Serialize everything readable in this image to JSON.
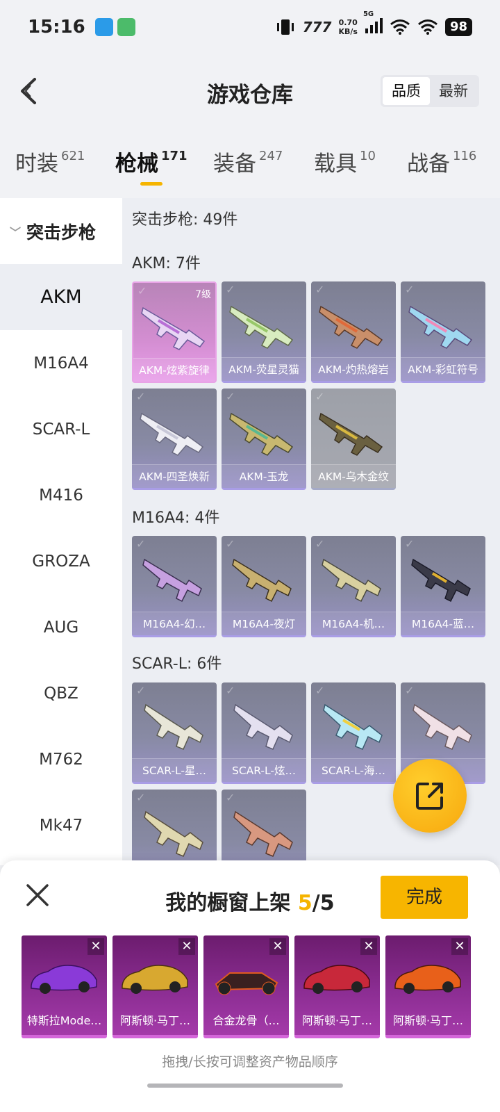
{
  "status": {
    "time": "15:16",
    "net_speed_value": "0.70",
    "net_speed_unit": "KB/s",
    "network": "5G",
    "battery": "98",
    "hd": "777"
  },
  "header": {
    "title": "游戏仓库",
    "sort_options": [
      "品质",
      "最新"
    ]
  },
  "tabs": [
    {
      "label": "时装",
      "count": "621"
    },
    {
      "label": "枪械",
      "count": "171"
    },
    {
      "label": "装备",
      "count": "247"
    },
    {
      "label": "载具",
      "count": "10"
    },
    {
      "label": "战备",
      "count": "116"
    }
  ],
  "sidebar": {
    "group": "突击步枪",
    "items": [
      "AKM",
      "M16A4",
      "SCAR-L",
      "M416",
      "GROZA",
      "AUG",
      "QBZ",
      "M762",
      "Mk47"
    ]
  },
  "content": {
    "category_title": "突击步枪: 49件",
    "sections": [
      {
        "title": "AKM: 7件",
        "items": [
          "AKM-炫紫旋律",
          "AKM-荧星灵猫",
          "AKM-灼热熔岩",
          "AKM-彩虹符号",
          "AKM-四圣焕新",
          "AKM-玉龙",
          "AKM-乌木金纹"
        ],
        "level_badge": "7级"
      },
      {
        "title": "M16A4: 4件",
        "items": [
          "M16A4-幻…",
          "M16A4-夜灯",
          "M16A4-机…",
          "M16A4-蓝…"
        ]
      },
      {
        "title": "SCAR-L: 6件",
        "items": [
          "SCAR-L-星…",
          "SCAR-L-炫…",
          "SCAR-L-海…",
          "…"
        ]
      }
    ]
  },
  "panel": {
    "title_prefix": "我的橱窗上架 ",
    "count_current": "5",
    "count_total": "/5",
    "done_label": "完成",
    "remove_symbol": "✕",
    "showcase": [
      "特斯拉Mode…",
      "阿斯顿·马丁…",
      "合金龙骨（…",
      "阿斯顿·马丁…",
      "阿斯顿·马丁…"
    ],
    "hint": "拖拽/长按可调整资产物品顺序"
  },
  "colors": {
    "accent": "#f5b400",
    "card_pink": "#d48ed2",
    "card_purple": "#9a93c8",
    "showcase_bg": "#8b2d92"
  },
  "icons": {
    "back": "back-arrow-icon",
    "close": "close-icon",
    "share": "share-icon",
    "wifi": "wifi-icon",
    "vibrate": "vibrate-icon"
  }
}
